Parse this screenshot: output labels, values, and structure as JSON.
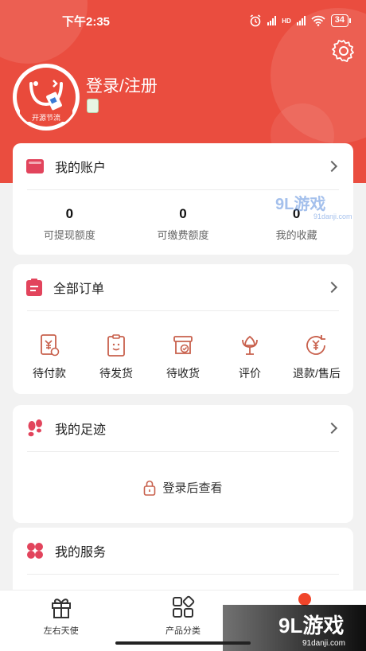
{
  "status_bar": {
    "time": "下午2:35",
    "battery": "34",
    "network_label": "HD"
  },
  "profile": {
    "login_label": "登录/注册",
    "avatar_text": "开源节流"
  },
  "account": {
    "title": "我的账户",
    "stats": [
      {
        "value": "0",
        "label": "可提现额度"
      },
      {
        "value": "0",
        "label": "可缴费额度"
      },
      {
        "value": "0",
        "label": "我的收藏"
      }
    ]
  },
  "orders": {
    "title": "全部订单",
    "items": [
      {
        "label": "待付款",
        "icon": "wallet-yen-icon"
      },
      {
        "label": "待发货",
        "icon": "clipboard-face-icon"
      },
      {
        "label": "待收货",
        "icon": "box-check-icon"
      },
      {
        "label": "评价",
        "icon": "flower-icon"
      },
      {
        "label": "退款/售后",
        "icon": "refund-yen-icon"
      }
    ]
  },
  "footprint": {
    "title": "我的足迹",
    "locked_text": "登录后查看"
  },
  "services": {
    "title": "我的服务"
  },
  "tabbar": {
    "items": [
      {
        "label": "左右天使",
        "icon": "gift-icon"
      },
      {
        "label": "产品分类",
        "icon": "category-icon"
      }
    ]
  },
  "watermarks": {
    "top_main": "9L游戏",
    "top_sub": "91danji.com",
    "bottom_main": "9L游戏",
    "bottom_sub": "91danji.com"
  },
  "colors": {
    "brand": "#ea4d3f",
    "icon_accent": "#e2445c",
    "order_icon": "#c8604c"
  }
}
